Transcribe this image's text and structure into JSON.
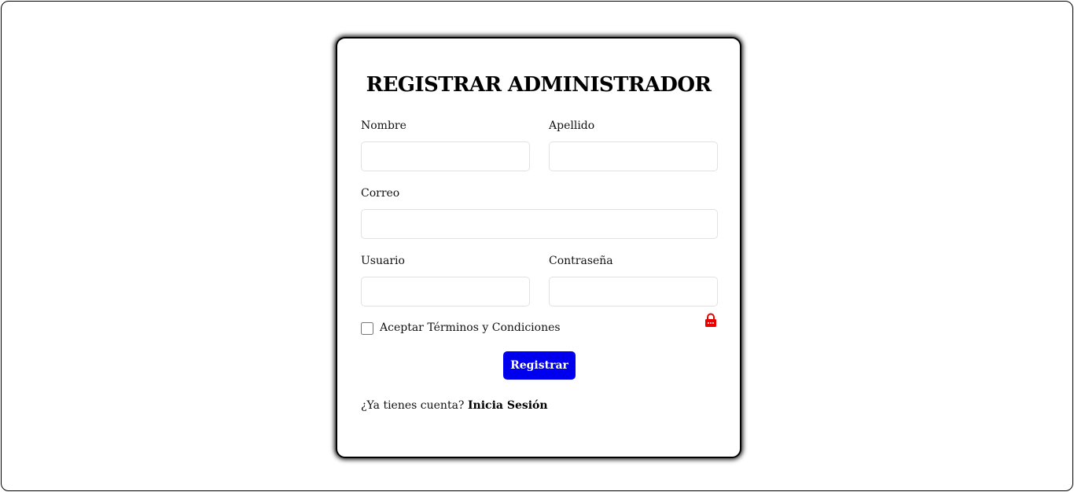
{
  "form": {
    "title": "REGISTRAR ADMINISTRADOR",
    "fields": {
      "nombre": {
        "label": "Nombre",
        "value": ""
      },
      "apellido": {
        "label": "Apellido",
        "value": ""
      },
      "correo": {
        "label": "Correo",
        "value": ""
      },
      "usuario": {
        "label": "Usuario",
        "value": ""
      },
      "contrasena": {
        "label": "Contraseña",
        "value": ""
      }
    },
    "terms_label": "Aceptar Términos y Condiciones",
    "submit_label": "Registrar",
    "footer_question": "¿Ya tienes cuenta?",
    "footer_link": "Inicia Sesión"
  },
  "icons": {
    "password_icon": "lock-icon"
  },
  "colors": {
    "button": "#0000ee",
    "lock_icon": "#ee0000"
  }
}
